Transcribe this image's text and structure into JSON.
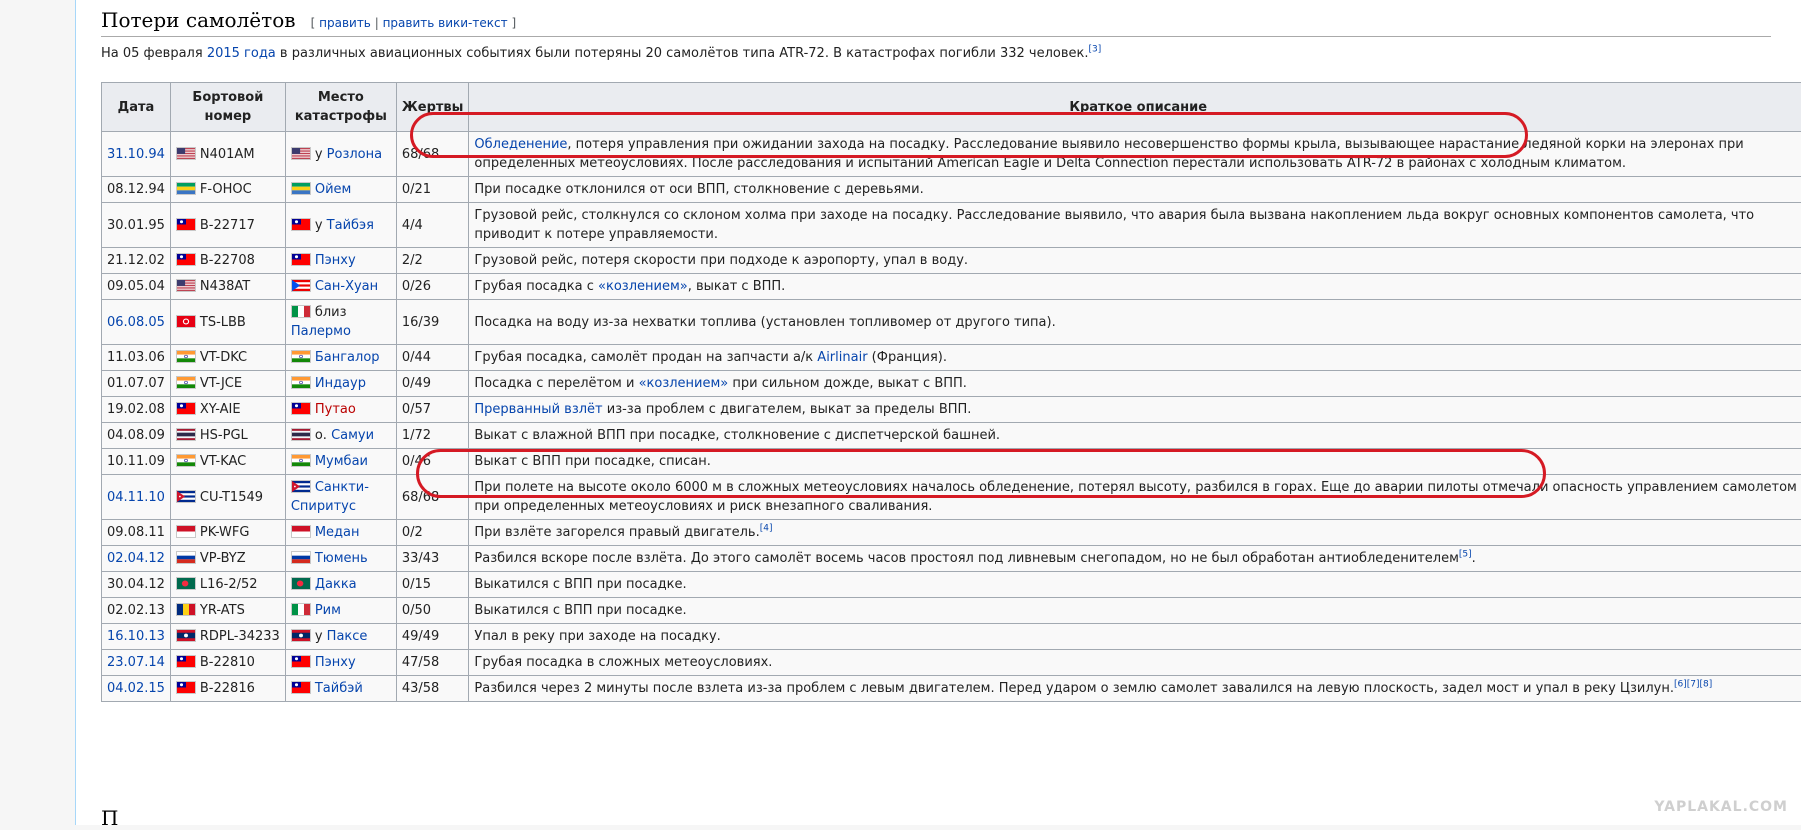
{
  "section": {
    "title": "Потери самолётов",
    "edit_open": "[",
    "edit_link": "править",
    "edit_sep": "|",
    "edit_source_link": "править вики-текст",
    "edit_close": "]"
  },
  "intro": {
    "prefix": "На 05 февраля ",
    "year_link": "2015 года",
    "text": " в различных авиационных событиях были потеряны 20 самолётов типа ATR-72. В катастрофах погибли 332 человек.",
    "ref": "[3]"
  },
  "table": {
    "headers": [
      "Дата",
      "Бортовой номер",
      "Место катастрофы",
      "Жертвы",
      "Краткое описание"
    ],
    "rows": [
      {
        "date": "31.10.94",
        "date_link": true,
        "flag": "us",
        "reg": "N401AM",
        "place_prefix": "у ",
        "place": "Розлона",
        "place_red": false,
        "victims": "68/68",
        "desc": [
          {
            "t": "Обледенение",
            "link": true
          },
          {
            "t": ", потеря управления при ожидании захода на посадку. Расследование выявило несовершенство формы крыла, вызывающее нарастание ледяной корки на элеронах при определенных метеоусловиях. После расследования и испытаний American Eagle и Delta Connection перестали использовать ATR-72 в районах с холодным климатом."
          }
        ]
      },
      {
        "date": "08.12.94",
        "date_link": false,
        "flag": "ga",
        "reg": "F-OHOC",
        "place_prefix": "",
        "place": "Ойем",
        "place_red": false,
        "victims": "0/21",
        "desc": [
          {
            "t": "При посадке отклонился от оси ВПП, столкновение с деревьями."
          }
        ]
      },
      {
        "date": "30.01.95",
        "date_link": false,
        "flag": "tw",
        "reg": "B-22717",
        "place_prefix": "у ",
        "place": "Тайбэя",
        "place_red": false,
        "victims": "4/4",
        "desc": [
          {
            "t": "Грузовой рейс, столкнулся со склоном холма при заходе на посадку. Расследование выявило, что авария была вызвана накоплением льда вокруг основных компонентов самолета, что приводит к потере управляемости."
          }
        ]
      },
      {
        "date": "21.12.02",
        "date_link": false,
        "flag": "tw",
        "reg": "B-22708",
        "place_prefix": "",
        "place": "Пэнху",
        "place_red": false,
        "victims": "2/2",
        "desc": [
          {
            "t": "Грузовой рейс, потеря скорости при подходе к аэропорту, упал в воду."
          }
        ]
      },
      {
        "date": "09.05.04",
        "date_link": false,
        "flag": "us",
        "reg": "N438AT",
        "place_prefix": "",
        "place": "Сан-Хуан",
        "place_red": false,
        "place_flag": "pr",
        "victims": "0/26",
        "desc": [
          {
            "t": "Грубая посадка с "
          },
          {
            "t": "«козлением»",
            "link": true
          },
          {
            "t": ", выкат с ВПП."
          }
        ]
      },
      {
        "date": "06.08.05",
        "date_link": true,
        "flag": "tn",
        "reg": "TS-LBB",
        "place_prefix": "близ ",
        "place": "Палермо",
        "place_red": false,
        "place_flag": "it",
        "victims": "16/39",
        "desc": [
          {
            "t": "Посадка на воду из-за нехватки топлива (установлен топливомер от другого типа)."
          }
        ]
      },
      {
        "date": "11.03.06",
        "date_link": false,
        "flag": "in",
        "reg": "VT-DKC",
        "place_prefix": "",
        "place": "Бангалор",
        "place_red": false,
        "victims": "0/44",
        "desc": [
          {
            "t": "Грубая посадка, самолёт продан на запчасти а/к "
          },
          {
            "t": "Airlinair",
            "link": true
          },
          {
            "t": " (Франция)."
          }
        ]
      },
      {
        "date": "01.07.07",
        "date_link": false,
        "flag": "in",
        "reg": "VT-JCE",
        "place_prefix": "",
        "place": "Индаур",
        "place_red": false,
        "victims": "0/49",
        "desc": [
          {
            "t": "Посадка с перелётом и "
          },
          {
            "t": "«козлением»",
            "link": true
          },
          {
            "t": " при сильном дожде, выкат с ВПП."
          }
        ]
      },
      {
        "date": "19.02.08",
        "date_link": false,
        "flag": "tw",
        "reg": "XY-AIE",
        "place_prefix": "",
        "place": "Путао",
        "place_red": true,
        "victims": "0/57",
        "desc": [
          {
            "t": "Прерванный взлёт",
            "link": true
          },
          {
            "t": " из-за проблем с двигателем, выкат за пределы ВПП."
          }
        ]
      },
      {
        "date": "04.08.09",
        "date_link": false,
        "flag": "th",
        "reg": "HS-PGL",
        "place_prefix": "о. ",
        "place": "Самуи",
        "place_red": false,
        "victims": "1/72",
        "desc": [
          {
            "t": "Выкат с влажной ВПП при посадке, столкновение с диспетчерской башней."
          }
        ]
      },
      {
        "date": "10.11.09",
        "date_link": false,
        "flag": "in",
        "reg": "VT-KAC",
        "place_prefix": "",
        "place": "Мумбаи",
        "place_red": false,
        "victims": "0/46",
        "desc": [
          {
            "t": "Выкат с ВПП при посадке, списан."
          }
        ]
      },
      {
        "date": "04.11.10",
        "date_link": true,
        "flag": "cu",
        "reg": "CU-T1549",
        "place_prefix": "",
        "place": "Санкти-Спиритус",
        "place_red": false,
        "victims": "68/68",
        "desc": [
          {
            "t": "При полете на высоте около 6000 м в сложных метеоусловиях началось обледенение, потерял высоту, разбился в горах. Еще до аварии пилоты отмечали опасность управлением самолетом при определенных метеоусловиях и риск внезапного сваливания."
          }
        ]
      },
      {
        "date": "09.08.11",
        "date_link": false,
        "flag": "id",
        "reg": "PK-WFG",
        "place_prefix": "",
        "place": "Медан",
        "place_red": false,
        "victims": "0/2",
        "desc": [
          {
            "t": "При взлёте загорелся правый двигатель."
          },
          {
            "t": "[4]",
            "sup": true
          }
        ]
      },
      {
        "date": "02.04.12",
        "date_link": true,
        "flag": "ru",
        "reg": "VP-BYZ",
        "place_prefix": "",
        "place": "Тюмень",
        "place_red": false,
        "victims": "33/43",
        "desc": [
          {
            "t": "Разбился вскоре после взлёта. До этого самолёт восемь часов простоял под ливневым снегопадом, но не был обработан антиобледенителем"
          },
          {
            "t": "[5]",
            "sup": true
          },
          {
            "t": "."
          }
        ]
      },
      {
        "date": "30.04.12",
        "date_link": false,
        "flag": "bd",
        "reg": "L16-2/52",
        "place_prefix": "",
        "place": "Дакка",
        "place_red": false,
        "victims": "0/15",
        "desc": [
          {
            "t": "Выкатился с ВПП при посадке."
          }
        ]
      },
      {
        "date": "02.02.13",
        "date_link": false,
        "flag": "ro",
        "reg": "YR-ATS",
        "place_prefix": "",
        "place": "Рим",
        "place_red": false,
        "place_flag": "it",
        "victims": "0/50",
        "desc": [
          {
            "t": "Выкатился с ВПП при посадке."
          }
        ]
      },
      {
        "date": "16.10.13",
        "date_link": true,
        "flag": "la",
        "reg": "RDPL-34233",
        "place_prefix": "у ",
        "place": "Паксе",
        "place_red": false,
        "victims": "49/49",
        "desc": [
          {
            "t": "Упал в реку при заходе на посадку."
          }
        ]
      },
      {
        "date": "23.07.14",
        "date_link": true,
        "flag": "tw",
        "reg": "B-22810",
        "place_prefix": "",
        "place": "Пэнху",
        "place_red": false,
        "victims": "47/58",
        "desc": [
          {
            "t": "Грубая посадка в сложных метеоусловиях."
          }
        ]
      },
      {
        "date": "04.02.15",
        "date_link": true,
        "flag": "tw",
        "reg": "B-22816",
        "place_prefix": "",
        "place": "Тайбэй",
        "place_red": false,
        "victims": "43/58",
        "desc": [
          {
            "t": "Разбился через 2 минуты после взлета из-за проблем с левым двигателем. Перед ударом о землю самолет завалился на левую плоскость, задел мост и упал в реку Цзилун."
          },
          {
            "t": "[6][7][8]",
            "sup": true
          }
        ]
      }
    ]
  },
  "watermark": "YAPLAKAL.COM",
  "next_heading": "П",
  "colors": {
    "link": "#0645ad",
    "redlink": "#ba0000",
    "highlight": "#d51a24"
  }
}
